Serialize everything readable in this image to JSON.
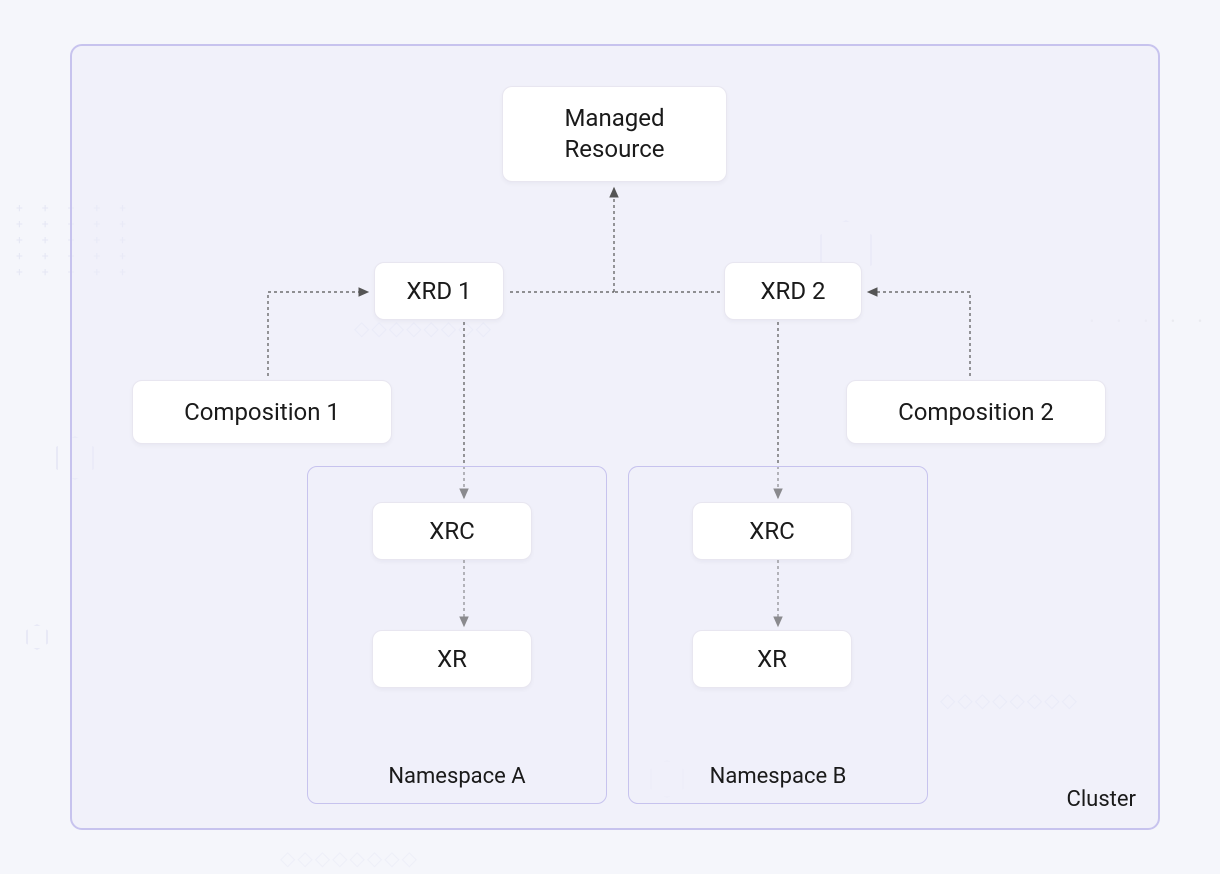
{
  "cluster": {
    "label": "Cluster"
  },
  "boxes": {
    "managed_resource": "Managed\nResource",
    "xrd1": "XRD 1",
    "xrd2": "XRD 2",
    "composition1": "Composition 1",
    "composition2": "Composition 2",
    "xrc_a": "XRC",
    "xr_a": "XR",
    "xrc_b": "XRC",
    "xr_b": "XR"
  },
  "namespaces": {
    "a": "Namespace A",
    "b": "Namespace B"
  }
}
